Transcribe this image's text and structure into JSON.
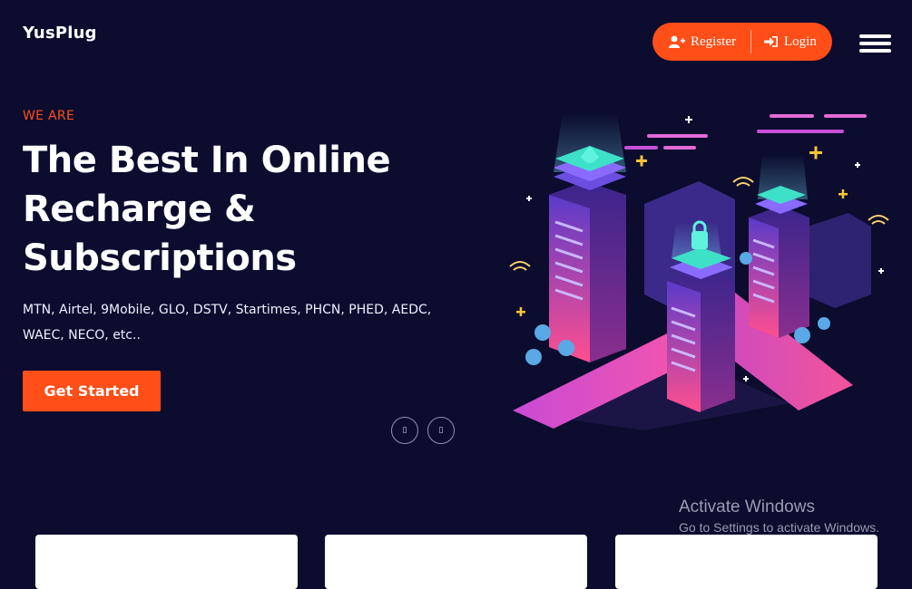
{
  "header": {
    "brand": "YusPlug",
    "register_label": "Register",
    "login_label": "Login"
  },
  "hero": {
    "eyebrow": "WE ARE",
    "headline_line1": "The Best In Online",
    "headline_line2": "Recharge &",
    "headline_line3": "Subscriptions",
    "subtitle": "MTN, Airtel, 9Mobile, GLO, DSTV, Startimes, PHCN, PHED, AEDC, WAEC, NECO, etc..",
    "cta_label": "Get Started",
    "prev_glyph": "▯",
    "next_glyph": "▯"
  },
  "watermark": {
    "title": "Activate Windows",
    "subtitle": "Go to Settings to activate Windows."
  },
  "colors": {
    "background": "#0b0c2e",
    "accent": "#ff4e18"
  },
  "icons": {
    "register": "user-plus-icon",
    "login": "sign-in-icon",
    "menu": "hamburger-menu-icon"
  }
}
